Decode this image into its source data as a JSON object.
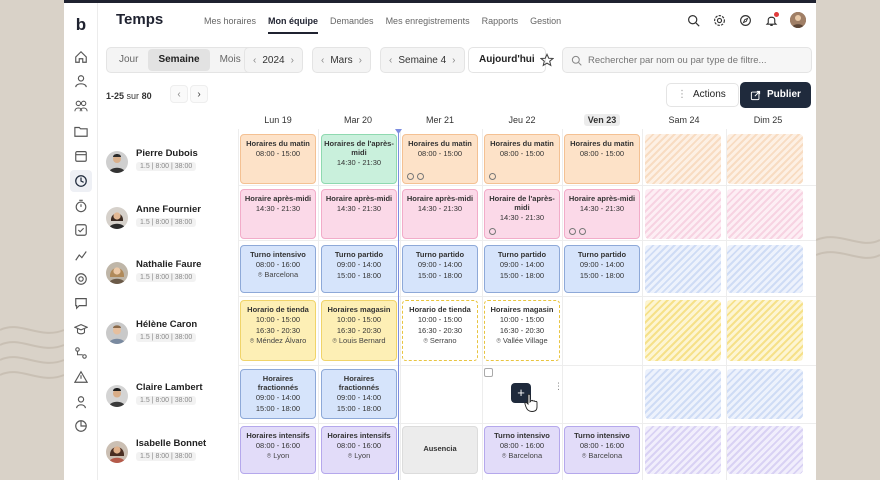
{
  "app": {
    "title": "Temps",
    "nav": [
      "Mes horaires",
      "Mon équipe",
      "Demandes",
      "Mes enregistrements",
      "Rapports",
      "Gestion"
    ],
    "active_nav": "Mon équipe"
  },
  "view": {
    "options": [
      "Jour",
      "Semaine",
      "Mois"
    ],
    "active": "Semaine",
    "year": "2024",
    "month": "Mars",
    "week": "Semaine 4",
    "today_label": "Aujourd'hui"
  },
  "search": {
    "placeholder": "Rechercher par nom ou par type de filtre..."
  },
  "pager": {
    "range": "1-25",
    "sep": "sur",
    "total": "80"
  },
  "buttons": {
    "actions": "Actions",
    "publish": "Publier"
  },
  "days": [
    "Lun 19",
    "Mar 20",
    "Mer 21",
    "Jeu 22",
    "Ven 23",
    "Sam 24",
    "Dim 25"
  ],
  "highlight_day": "Ven 23",
  "employees": [
    {
      "name": "Pierre Dubois",
      "meta": "1.5 | 8:00 | 38:00"
    },
    {
      "name": "Anne Fournier",
      "meta": "1.5 | 8:00 | 38:00"
    },
    {
      "name": "Nathalie Faure",
      "meta": "1.5 | 8:00 | 38:00"
    },
    {
      "name": "Hélène Caron",
      "meta": "1.5 | 8:00 | 38:00"
    },
    {
      "name": "Claire Lambert",
      "meta": "1.5 | 8:00 | 38:00"
    },
    {
      "name": "Isabelle Bonnet",
      "meta": "1.5 | 8:00 | 38:00"
    }
  ],
  "shifts": {
    "r0": [
      {
        "title": "Horaires du matin",
        "hours": [
          "08:00 - 15:00"
        ],
        "color": "orange"
      },
      {
        "title": "Horaires de l'après-midi",
        "hours": [
          "14:30 - 21:30"
        ],
        "color": "green"
      },
      {
        "title": "Horaires du matin",
        "hours": [
          "08:00 - 15:00"
        ],
        "color": "orange",
        "icons": true
      },
      {
        "title": "Horaires du matin",
        "hours": [
          "08:00 - 15:00"
        ],
        "color": "orange",
        "icons": true
      },
      {
        "title": "Horaires du matin",
        "hours": [
          "08:00 - 15:00"
        ],
        "color": "orange"
      }
    ],
    "r1": [
      {
        "title": "Horaire après-midi",
        "hours": [
          "14:30 - 21:30"
        ],
        "color": "pink"
      },
      {
        "title": "Horaire après-midi",
        "hours": [
          "14:30 - 21:30"
        ],
        "color": "pink"
      },
      {
        "title": "Horaire après-midi",
        "hours": [
          "14:30 - 21:30"
        ],
        "color": "pink"
      },
      {
        "title": "Horaire de l'après-midi",
        "hours": [
          "14:30 - 21:30"
        ],
        "color": "pink",
        "icons": true
      },
      {
        "title": "Horaire après-midi",
        "hours": [
          "14:30 - 21:30"
        ],
        "color": "pink",
        "icons": true
      }
    ],
    "r2": [
      {
        "title": "Turno intensivo",
        "hours": [
          "08:00 - 16:00"
        ],
        "location": "Barcelona",
        "color": "blue"
      },
      {
        "title": "Turno partido",
        "hours": [
          "09:00 - 14:00",
          "15:00 - 18:00"
        ],
        "color": "blue"
      },
      {
        "title": "Turno partido",
        "hours": [
          "09:00 - 14:00",
          "15:00 - 18:00"
        ],
        "color": "blue"
      },
      {
        "title": "Turno partido",
        "hours": [
          "09:00 - 14:00",
          "15:00 - 18:00"
        ],
        "color": "blue"
      },
      {
        "title": "Turno partido",
        "hours": [
          "09:00 - 14:00",
          "15:00 - 18:00"
        ],
        "color": "blue"
      }
    ],
    "r3": [
      {
        "title": "Horario de tienda",
        "hours": [
          "10:00 - 15:00",
          "16:30 - 20:30"
        ],
        "location": "Méndez Álvaro",
        "color": "yellow"
      },
      {
        "title": "Horaires magasin",
        "hours": [
          "10:00 - 15:00",
          "16:30 - 20:30"
        ],
        "location": "Louis Bernard",
        "color": "yellow"
      },
      {
        "title": "Horario de tienda",
        "hours": [
          "10:00 - 15:00",
          "16:30 - 20:30"
        ],
        "location": "Serrano",
        "color": "dashed"
      },
      {
        "title": "Horaires magasin",
        "hours": [
          "10:00 - 15:00",
          "16:30 - 20:30"
        ],
        "location": "Vallée Village",
        "color": "dashed"
      }
    ],
    "r4": [
      {
        "title": "Horaires fractionnés",
        "hours": [
          "09:00 - 14:00",
          "15:00 - 18:00"
        ],
        "color": "blue"
      },
      {
        "title": "Horaires fractionnés",
        "hours": [
          "09:00 - 14:00",
          "15:00 - 18:00"
        ],
        "color": "blue"
      }
    ],
    "r5": [
      {
        "title": "Horaires intensifs",
        "hours": [
          "08:00 - 16:00"
        ],
        "location": "Lyon",
        "color": "purple"
      },
      {
        "title": "Horaires intensifs",
        "hours": [
          "08:00 - 16:00"
        ],
        "location": "Lyon",
        "color": "purple"
      },
      {
        "title": "Ausencia",
        "hours": [],
        "color": "gray"
      },
      {
        "title": "Turno intensivo",
        "hours": [
          "08:00 - 16:00"
        ],
        "location": "Barcelona",
        "color": "purple"
      },
      {
        "title": "Turno intensivo",
        "hours": [
          "08:00 - 16:00"
        ],
        "location": "Barcelona",
        "color": "purple"
      }
    ]
  },
  "colors": {
    "accent": "#1f2a3c",
    "now_line": "#7c8de0",
    "notification": "#e03b3b"
  }
}
